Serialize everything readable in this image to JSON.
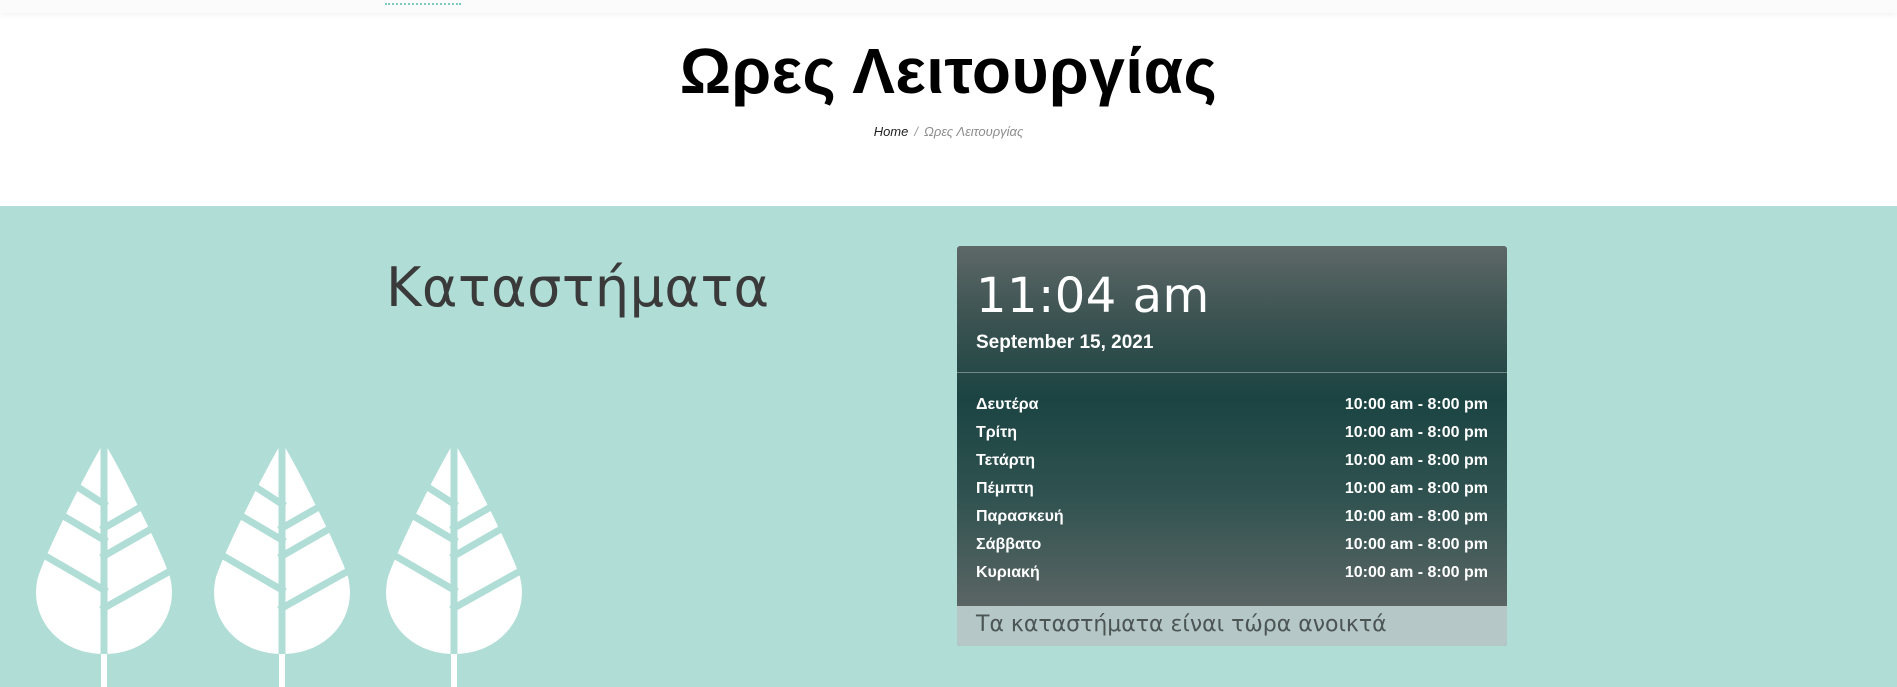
{
  "header": {
    "title": "Ωρες Λειτουργίας",
    "breadcrumb": {
      "home": "Home",
      "separator": "/",
      "current": "Ωρες Λειτουργίας"
    }
  },
  "section": {
    "heading": "Καταστήματα",
    "background_color": "#b0ddd6"
  },
  "hours_card": {
    "time": "11:04 am",
    "date": "September 15, 2021",
    "days": [
      {
        "day": "Δευτέρα",
        "hours": "10:00 am - 8:00 pm"
      },
      {
        "day": "Τρίτη",
        "hours": "10:00 am - 8:00 pm"
      },
      {
        "day": "Τετάρτη",
        "hours": "10:00 am - 8:00 pm"
      },
      {
        "day": "Πέμπτη",
        "hours": "10:00 am - 8:00 pm"
      },
      {
        "day": "Παρασκευή",
        "hours": "10:00 am - 8:00 pm"
      },
      {
        "day": "Σάββατο",
        "hours": "10:00 am - 8:00 pm"
      },
      {
        "day": "Κυριακή",
        "hours": "10:00 am - 8:00 pm"
      }
    ],
    "status": "Τα καταστήματα είναι τώρα ανοικτά"
  },
  "decoration": {
    "icon": "leaf-icon",
    "count": 3,
    "color": "#ffffff"
  }
}
